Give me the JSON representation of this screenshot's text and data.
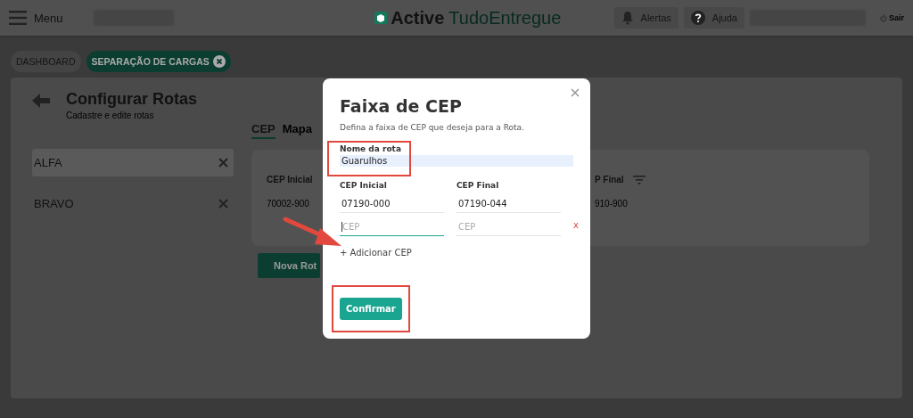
{
  "header": {
    "menu_label": "Menu",
    "logo": {
      "bold": "Active",
      "light": "TudoEntregue"
    },
    "buttons": [
      {
        "kind": "bell",
        "label": "Alertas"
      },
      {
        "kind": "help",
        "label": "Ajuda"
      }
    ],
    "logout": "Sair"
  },
  "breadcrumbs": [
    {
      "label": "DASHBOARD",
      "selected": false,
      "closable": false
    },
    {
      "label": "SEPARAÇÃO DE CARGAS",
      "selected": true,
      "closable": true
    }
  ],
  "page": {
    "title": "Configurar Rotas",
    "subtitle": "Cadastre e edite rotas"
  },
  "routes": [
    {
      "name": "ALFA",
      "selected": true
    },
    {
      "name": "BRAVO",
      "selected": false
    }
  ],
  "tabs": [
    {
      "label": "CEP",
      "selected": true
    },
    {
      "label": "Mapa",
      "selected": false
    }
  ],
  "table": {
    "column_1": "CEP Inicial",
    "column_2": "P Final",
    "rows": [
      [
        "70002-900",
        "910-900"
      ]
    ]
  },
  "new_route_button": "Nova Rot",
  "dialog": {
    "title": "Faixa de CEP",
    "description": "Defina a faixa de CEP que deseja para a Rota.",
    "name_field": {
      "label": "Nome da rota",
      "value": "Guarulhos",
      "highlighted": true
    },
    "columns": [
      "CEP Inicial",
      "CEP Final"
    ],
    "cep_rows": [
      {
        "inicial": {
          "value": "07190-000",
          "focused": false
        },
        "final": {
          "value": "07190-044",
          "focused": false
        }
      },
      {
        "inicial": {
          "placeholder": "CEP",
          "focused": true
        },
        "final": {
          "placeholder": "CEP",
          "focused": false
        },
        "remove": "x"
      }
    ],
    "add_link": {
      "label": "+ Adicionar CEP",
      "pointer_arrow": true
    },
    "confirm_button": {
      "label": "Confirmar",
      "highlighted": true
    }
  }
}
